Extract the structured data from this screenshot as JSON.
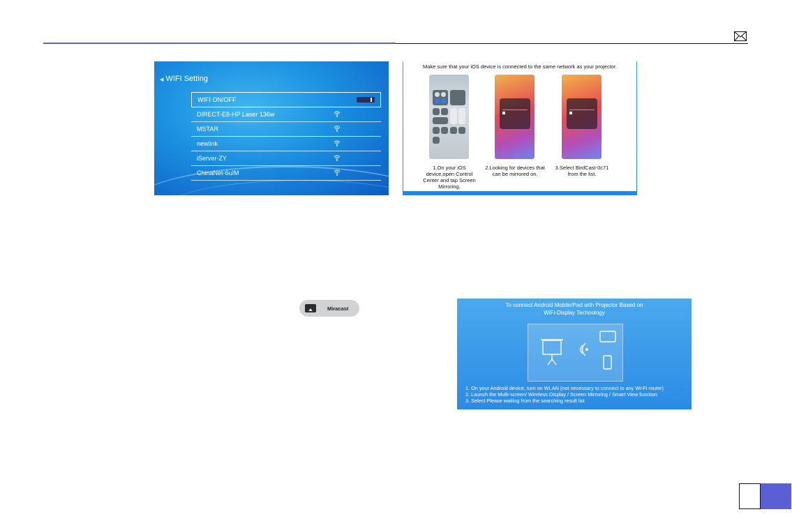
{
  "wifi_panel": {
    "title": "WIFI Setting",
    "networks": [
      {
        "name": "WIFI ON/OFF"
      },
      {
        "name": "DIRECT-E8-HP Laser 136w"
      },
      {
        "name": "MSTAR"
      },
      {
        "name": "newlink"
      },
      {
        "name": "iServer-ZY"
      },
      {
        "name": "ChinaNet-6uIM"
      }
    ]
  },
  "ios_panel": {
    "heading": "Make sure that your iOS device is connected to the same network as your projector.",
    "steps": [
      "1.On your iOS device,open Control Center and tap Screen Mirroring.",
      "2.Looking for devices that can be mirrored on.",
      "3.Select BirdCast-0c71 from the list."
    ]
  },
  "miracast": {
    "label": "Miracast"
  },
  "android_panel": {
    "title_line1": "To connect Android Mobile/Pad with Projector Based on",
    "title_line2": "WiFi-Display Technology",
    "steps": [
      "1. On your Android device, turn on WLAN (not necessary to connect to any Wi-Fi router)",
      "2. Launch the Multi-screen/ Wireless Display / Screen Mirroring / Smart View function",
      "3. Select Please waiting from the searching result list"
    ]
  },
  "colors": {
    "accent": "#5b5fd6",
    "panel_blue": "#1b8fe0"
  },
  "icons": {
    "mail": "mail-icon"
  }
}
